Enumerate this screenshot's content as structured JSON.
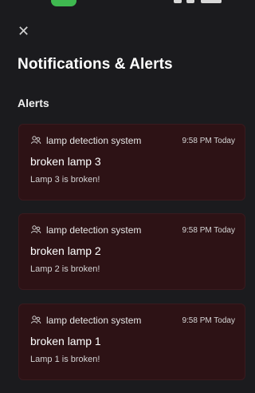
{
  "header": {
    "title": "Notifications & Alerts",
    "close_icon": "close-icon"
  },
  "alerts": {
    "section_title": "Alerts",
    "items": [
      {
        "source": "lamp detection system",
        "time": "9:58 PM Today",
        "title": "broken lamp 3",
        "body": "Lamp 3 is broken!",
        "icon": "users-icon"
      },
      {
        "source": "lamp detection system",
        "time": "9:58 PM Today",
        "title": "broken lamp 2",
        "body": "Lamp 2 is broken!",
        "icon": "users-icon"
      },
      {
        "source": "lamp detection system",
        "time": "9:58 PM Today",
        "title": "broken lamp 1",
        "body": "Lamp 1 is broken!",
        "icon": "users-icon"
      }
    ]
  },
  "colors": {
    "background": "#1b1b1e",
    "alert_card": "#2d1215",
    "status_pill": "#3fb950"
  }
}
